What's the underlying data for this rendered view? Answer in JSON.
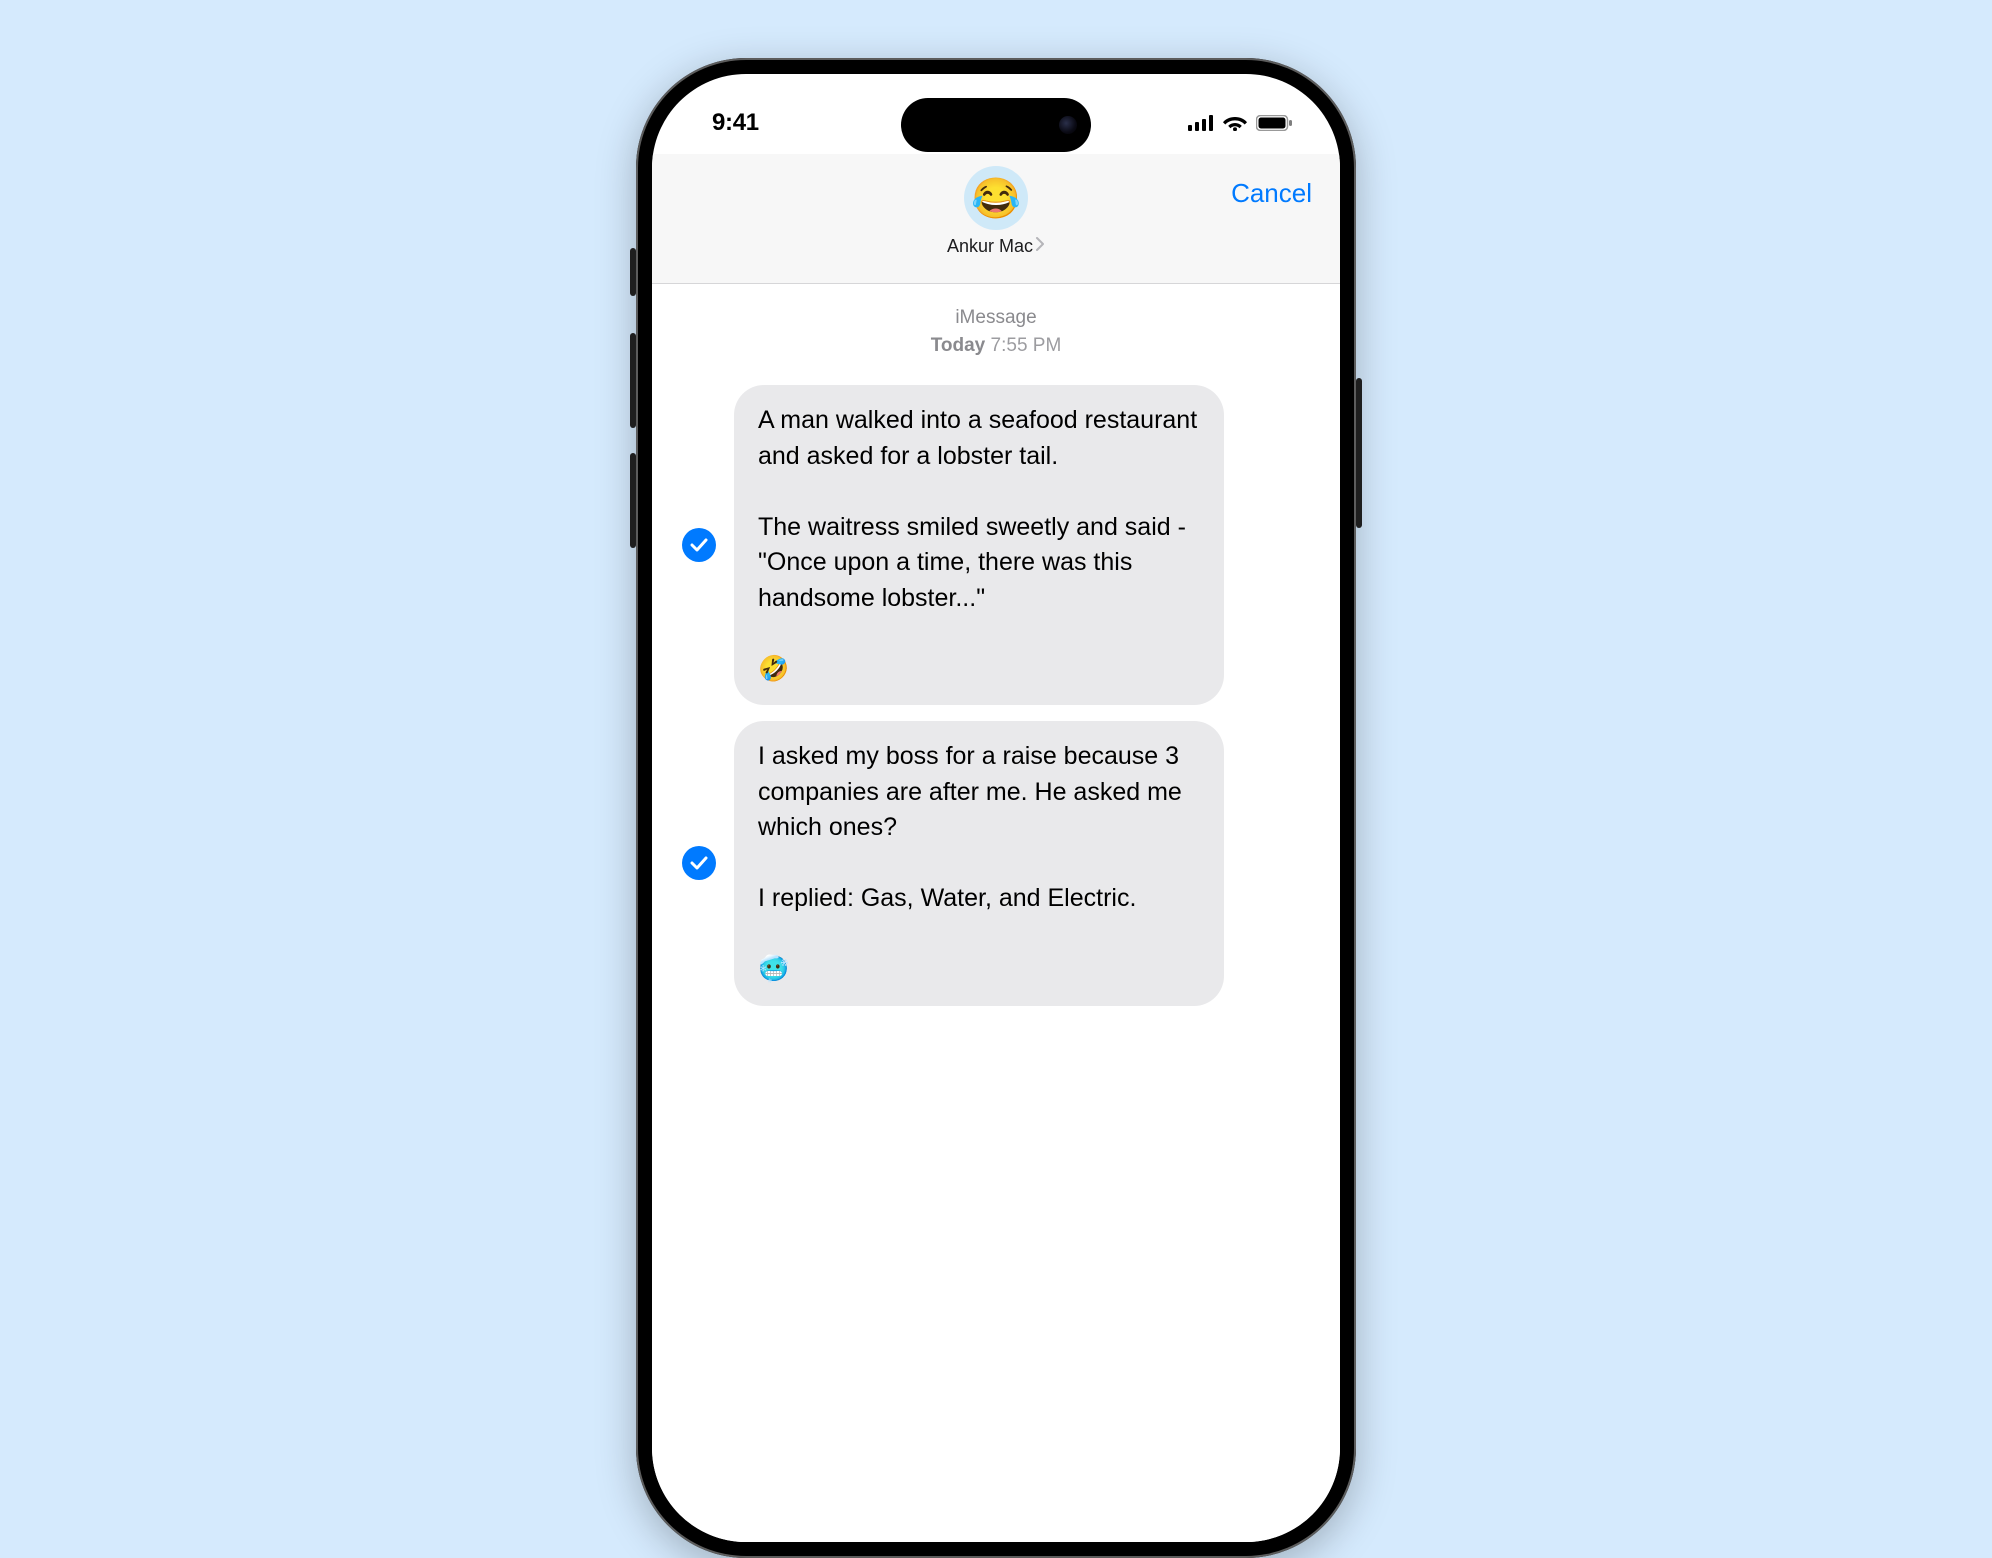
{
  "statusbar": {
    "time": "9:41"
  },
  "header": {
    "avatar_emoji": "😂",
    "contact_name": "Ankur Mac",
    "cancel_label": "Cancel"
  },
  "thread": {
    "service_label": "iMessage",
    "day_label": "Today",
    "time_label": "7:55 PM",
    "messages": [
      {
        "selected": true,
        "text": "A man walked into a seafood restaurant and asked for a lobster tail.\n\nThe waitress smiled sweetly and said - \"Once upon a time, there was this handsome lobster...\"\n\n🤣"
      },
      {
        "selected": true,
        "text": "I asked my boss for a raise because 3 companies are after me. He asked me which ones?\n\nI replied: Gas, Water, and Electric.\n\n🥶"
      }
    ]
  }
}
